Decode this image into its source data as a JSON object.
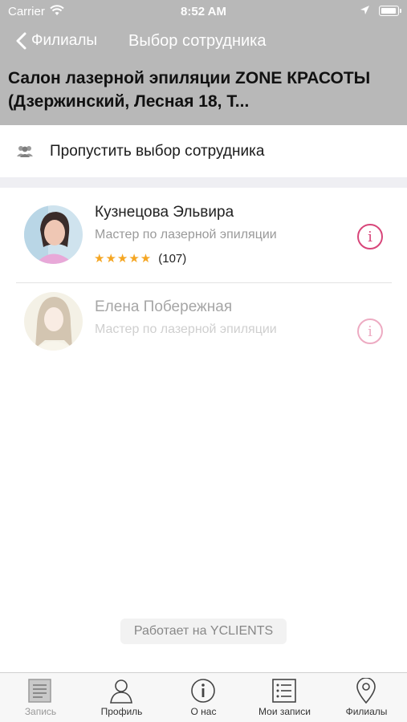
{
  "status_bar": {
    "carrier": "Carrier",
    "time": "8:52 AM"
  },
  "nav": {
    "back_label": "Филиалы",
    "title": "Выбор сотрудника"
  },
  "salon": {
    "title": "Салон лазерной эпиляции ZONE КРАСОТЫ (Дзержинский, Лесная 18, Т..."
  },
  "skip": {
    "label": "Пропустить выбор сотрудника",
    "icon": "group-icon"
  },
  "staff": [
    {
      "name": "Кузнецова Эльвира",
      "role": "Мастер по лазерной эпиляции",
      "stars": "★★★★★",
      "rating": 5,
      "reviews": "(107)",
      "available": true
    },
    {
      "name": "Елена Побережная",
      "role": "Мастер по лазерной эпиляции",
      "available": false
    }
  ],
  "powered_by": "Работает на YCLIENTS",
  "tabs": [
    {
      "label": "Запись",
      "icon": "book-icon",
      "enabled": false
    },
    {
      "label": "Профиль",
      "icon": "profile-icon",
      "enabled": true
    },
    {
      "label": "О нас",
      "icon": "info-icon",
      "enabled": true
    },
    {
      "label": "Мои записи",
      "icon": "list-icon",
      "enabled": true
    },
    {
      "label": "Филиалы",
      "icon": "location-pin-icon",
      "enabled": true
    }
  ],
  "colors": {
    "header_bg": "#b8b8b8",
    "accent": "#d8467a",
    "star": "#f5a623"
  }
}
